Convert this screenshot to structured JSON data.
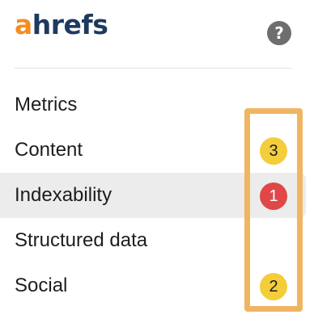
{
  "header": {
    "logo_a": "a",
    "logo_rest": "hrefs",
    "help_icon": "question-circle-icon",
    "help_glyph": "?"
  },
  "menu": {
    "items": [
      {
        "label": "Metrics",
        "badge": ""
      },
      {
        "label": "Content",
        "badge": "3",
        "badge_status": "warning"
      },
      {
        "label": "Indexability",
        "badge": "1",
        "badge_status": "error",
        "active": true
      },
      {
        "label": "Structured data",
        "badge": ""
      },
      {
        "label": "Social",
        "badge": "2",
        "badge_status": "warning"
      }
    ]
  },
  "colors": {
    "brand_orange": "#f48c1f",
    "brand_navy": "#1f3a5f",
    "warning_badge": "#f4cd3b",
    "error_badge": "#e04747",
    "highlight_outline": "#f0b562",
    "active_row": "#ececec"
  }
}
